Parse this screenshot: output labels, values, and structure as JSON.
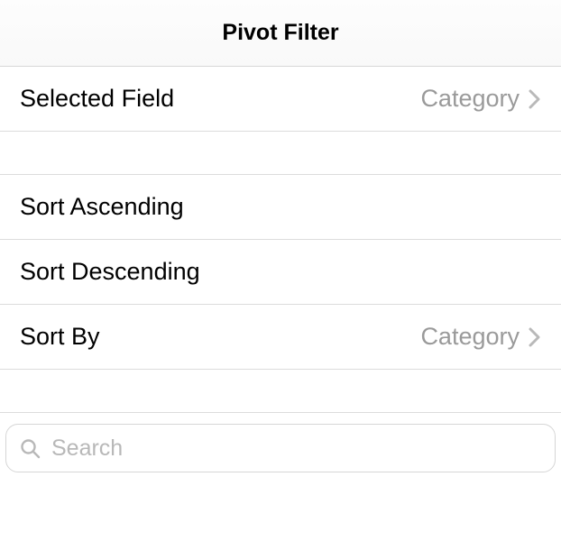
{
  "header": {
    "title": "Pivot Filter"
  },
  "rows": {
    "selected_field": {
      "label": "Selected Field",
      "value": "Category"
    },
    "sort_ascending": {
      "label": "Sort Ascending"
    },
    "sort_descending": {
      "label": "Sort Descending"
    },
    "sort_by": {
      "label": "Sort By",
      "value": "Category"
    }
  },
  "search": {
    "placeholder": "Search",
    "value": ""
  }
}
